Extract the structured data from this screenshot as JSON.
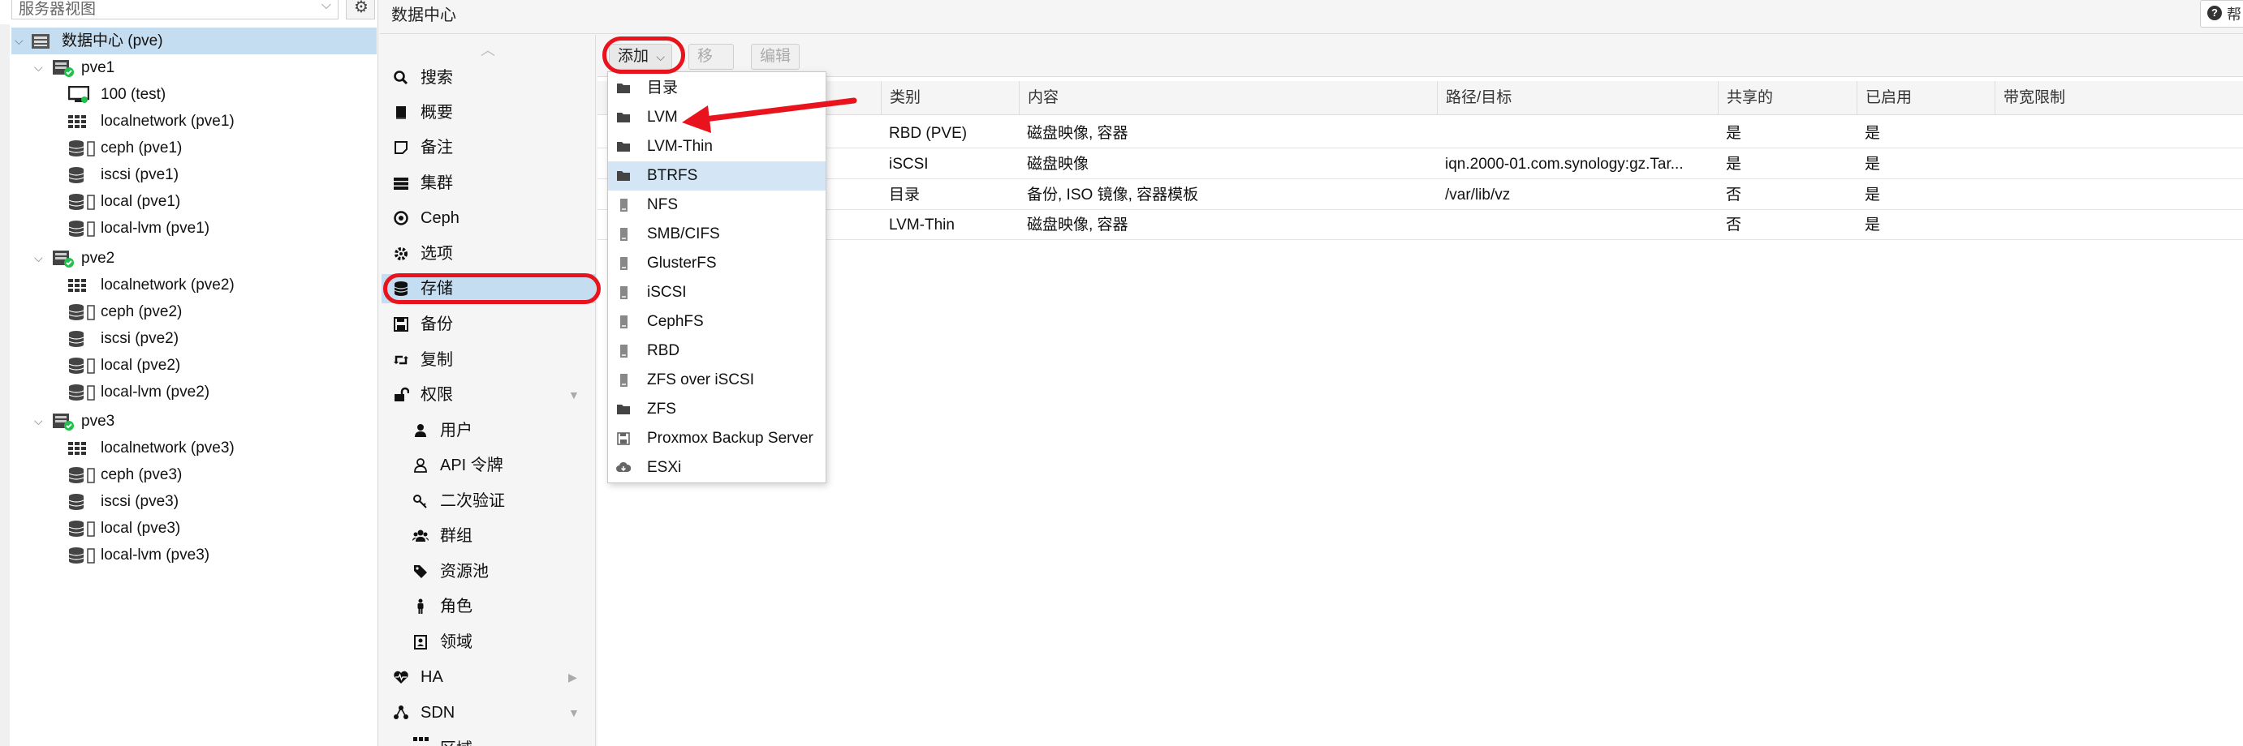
{
  "left": {
    "view_label": "服务器视图",
    "tree": [
      {
        "label": "数据中心 (pve)",
        "icon": "datacenter-icon"
      },
      {
        "label": "pve1",
        "icon": "node-online-icon"
      },
      {
        "label": "100 (test)",
        "icon": "vm-icon"
      },
      {
        "label": "localnetwork (pve1)",
        "icon": "network-grid-icon"
      },
      {
        "label": "ceph (pve1)",
        "icon": "storage-icon"
      },
      {
        "label": "iscsi (pve1)",
        "icon": "storage-icon"
      },
      {
        "label": "local (pve1)",
        "icon": "storage-icon"
      },
      {
        "label": "local-lvm (pve1)",
        "icon": "storage-icon"
      },
      {
        "label": "pve2",
        "icon": "node-online-icon"
      },
      {
        "label": "localnetwork (pve2)",
        "icon": "network-grid-icon"
      },
      {
        "label": "ceph (pve2)",
        "icon": "storage-icon"
      },
      {
        "label": "iscsi (pve2)",
        "icon": "storage-icon"
      },
      {
        "label": "local (pve2)",
        "icon": "storage-icon"
      },
      {
        "label": "local-lvm (pve2)",
        "icon": "storage-icon"
      },
      {
        "label": "pve3",
        "icon": "node-online-icon"
      },
      {
        "label": "localnetwork (pve3)",
        "icon": "network-grid-icon"
      },
      {
        "label": "ceph (pve3)",
        "icon": "storage-icon"
      },
      {
        "label": "iscsi (pve3)",
        "icon": "storage-icon"
      },
      {
        "label": "local (pve3)",
        "icon": "storage-icon"
      },
      {
        "label": "local-lvm (pve3)",
        "icon": "storage-icon"
      }
    ]
  },
  "header": {
    "title": "数据中心",
    "help_label": "帮"
  },
  "nav": {
    "items": [
      {
        "label": "搜索",
        "icon": "search-icon"
      },
      {
        "label": "概要",
        "icon": "book-icon"
      },
      {
        "label": "备注",
        "icon": "note-icon"
      },
      {
        "label": "集群",
        "icon": "server-stack-icon"
      },
      {
        "label": "Ceph",
        "icon": "ceph-icon"
      },
      {
        "label": "选项",
        "icon": "gear-icon"
      },
      {
        "label": "存储",
        "icon": "database-icon"
      },
      {
        "label": "备份",
        "icon": "floppy-icon"
      },
      {
        "label": "复制",
        "icon": "retweet-icon"
      },
      {
        "label": "权限",
        "icon": "unlock-icon"
      },
      {
        "label": "用户",
        "icon": "user-icon"
      },
      {
        "label": "API 令牌",
        "icon": "user-outline-icon"
      },
      {
        "label": "二次验证",
        "icon": "key-icon"
      },
      {
        "label": "群组",
        "icon": "users-icon"
      },
      {
        "label": "资源池",
        "icon": "tags-icon"
      },
      {
        "label": "角色",
        "icon": "male-icon"
      },
      {
        "label": "领域",
        "icon": "address-book-icon"
      },
      {
        "label": "HA",
        "icon": "heartbeat-icon"
      },
      {
        "label": "SDN",
        "icon": "sdn-icon"
      },
      {
        "label": "区域",
        "icon": "grid-icon"
      }
    ]
  },
  "toolbar": {
    "add_label": "添加",
    "remove_label": "移除",
    "edit_label": "编辑"
  },
  "grid": {
    "columns": [
      "类别",
      "内容",
      "路径/目标",
      "共享的",
      "已启用",
      "带宽限制"
    ],
    "rows": [
      [
        "RBD (PVE)",
        "磁盘映像, 容器",
        "",
        "是",
        "是",
        ""
      ],
      [
        "iSCSI",
        "磁盘映像",
        "iqn.2000-01.com.synology:gz.Tar...",
        "是",
        "是",
        ""
      ],
      [
        "目录",
        "备份, ISO 镜像, 容器模板",
        "/var/lib/vz",
        "否",
        "是",
        ""
      ],
      [
        "LVM-Thin",
        "磁盘映像, 容器",
        "",
        "否",
        "是",
        ""
      ]
    ]
  },
  "add_menu": {
    "items": [
      {
        "label": "目录",
        "icon": "folder-icon"
      },
      {
        "label": "LVM",
        "icon": "folder-icon"
      },
      {
        "label": "LVM-Thin",
        "icon": "folder-icon"
      },
      {
        "label": "BTRFS",
        "icon": "folder-icon"
      },
      {
        "label": "NFS",
        "icon": "server-icon"
      },
      {
        "label": "SMB/CIFS",
        "icon": "server-icon"
      },
      {
        "label": "GlusterFS",
        "icon": "server-icon"
      },
      {
        "label": "iSCSI",
        "icon": "server-icon"
      },
      {
        "label": "CephFS",
        "icon": "server-icon"
      },
      {
        "label": "RBD",
        "icon": "server-icon"
      },
      {
        "label": "ZFS over iSCSI",
        "icon": "server-icon"
      },
      {
        "label": "ZFS",
        "icon": "folder-icon"
      },
      {
        "label": "Proxmox Backup Server",
        "icon": "floppy-icon"
      },
      {
        "label": "ESXi",
        "icon": "cloud-download-icon"
      }
    ],
    "highlighted": "BTRFS"
  },
  "colors": {
    "selection": "#c5ddf0",
    "menu_highlight": "#d4e6f5",
    "annotation_red": "#e8131c",
    "node_status_green": "#21bf4b"
  }
}
